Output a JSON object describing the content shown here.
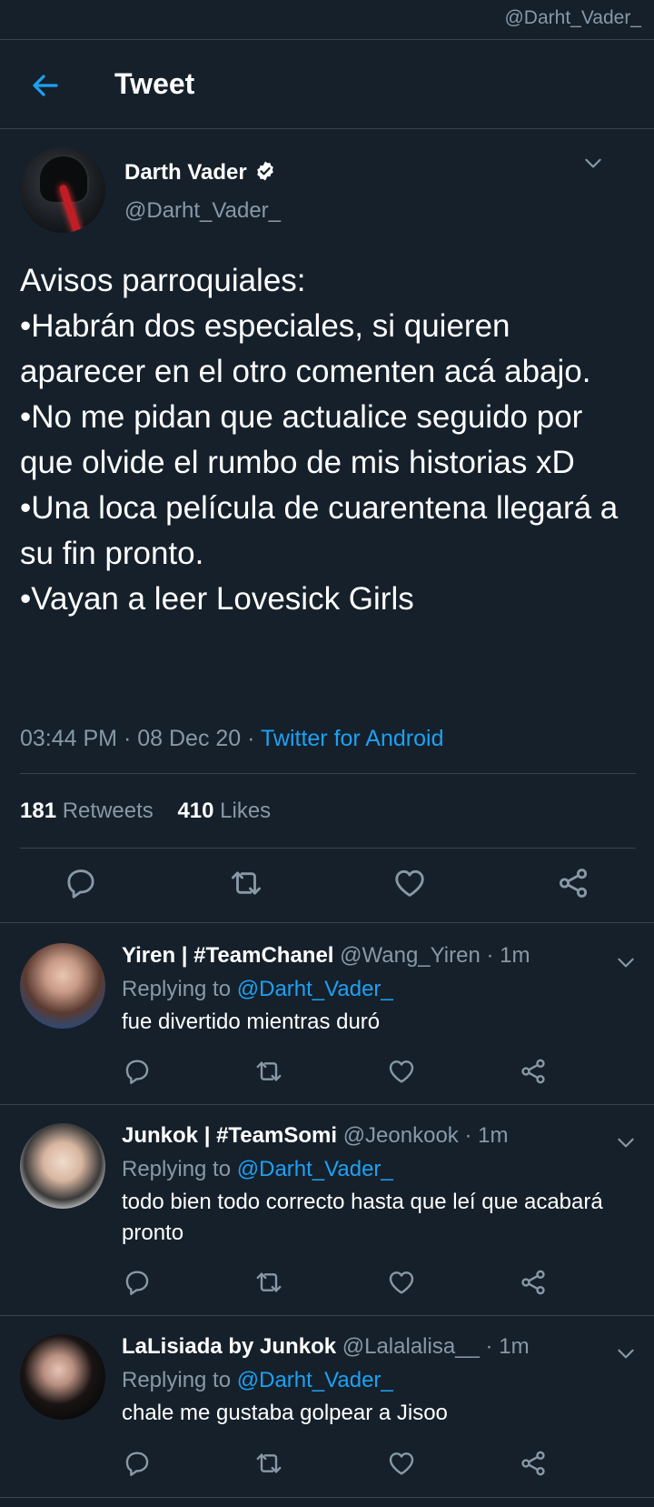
{
  "watermark": "@Darht_Vader_",
  "header": {
    "title": "Tweet"
  },
  "tweet": {
    "name": "Darth Vader",
    "handle": "@Darht_Vader_",
    "text": "Avisos parroquiales:\n•Habrán dos especiales, si quieren aparecer en el otro comenten acá abajo.\n•No me pidan que actualice seguido por que olvide el rumbo de mis historias xD\n•Una loca película de cuarentena llegará a su fin pronto.\n•Vayan a leer Lovesick Girls",
    "time": "03:44 PM",
    "date": "08 Dec 20",
    "source": "Twitter for Android",
    "retweets_count": "181",
    "retweets_label": "Retweets",
    "likes_count": "410",
    "likes_label": "Likes"
  },
  "replies": [
    {
      "name": "Yiren | #TeamChanel",
      "handle": "@Wang_Yiren",
      "time": "1m",
      "replying_prefix": "Replying to",
      "replying_to": "@Darht_Vader_",
      "text": "fue divertido mientras duró"
    },
    {
      "name": "Junkok | #TeamSomi",
      "handle": "@Jeonkook",
      "time": "1m",
      "replying_prefix": "Replying to",
      "replying_to": "@Darht_Vader_",
      "text": "todo bien todo correcto hasta que leí que acabará pronto"
    },
    {
      "name": "LaLisiada by Junkok",
      "handle": "@Lalalalisa__",
      "time": "1m",
      "replying_prefix": "Replying to",
      "replying_to": "@Darht_Vader_",
      "text": "chale me gustaba golpear a Jisoo"
    }
  ],
  "colors": {
    "background": "#15202b",
    "accent": "#1da1f2",
    "secondary_text": "#8899a6",
    "divider": "#38444d"
  },
  "icons": [
    "back-arrow-icon",
    "verified-badge-icon",
    "chevron-down-icon",
    "reply-icon",
    "retweet-icon",
    "like-icon",
    "share-icon"
  ]
}
